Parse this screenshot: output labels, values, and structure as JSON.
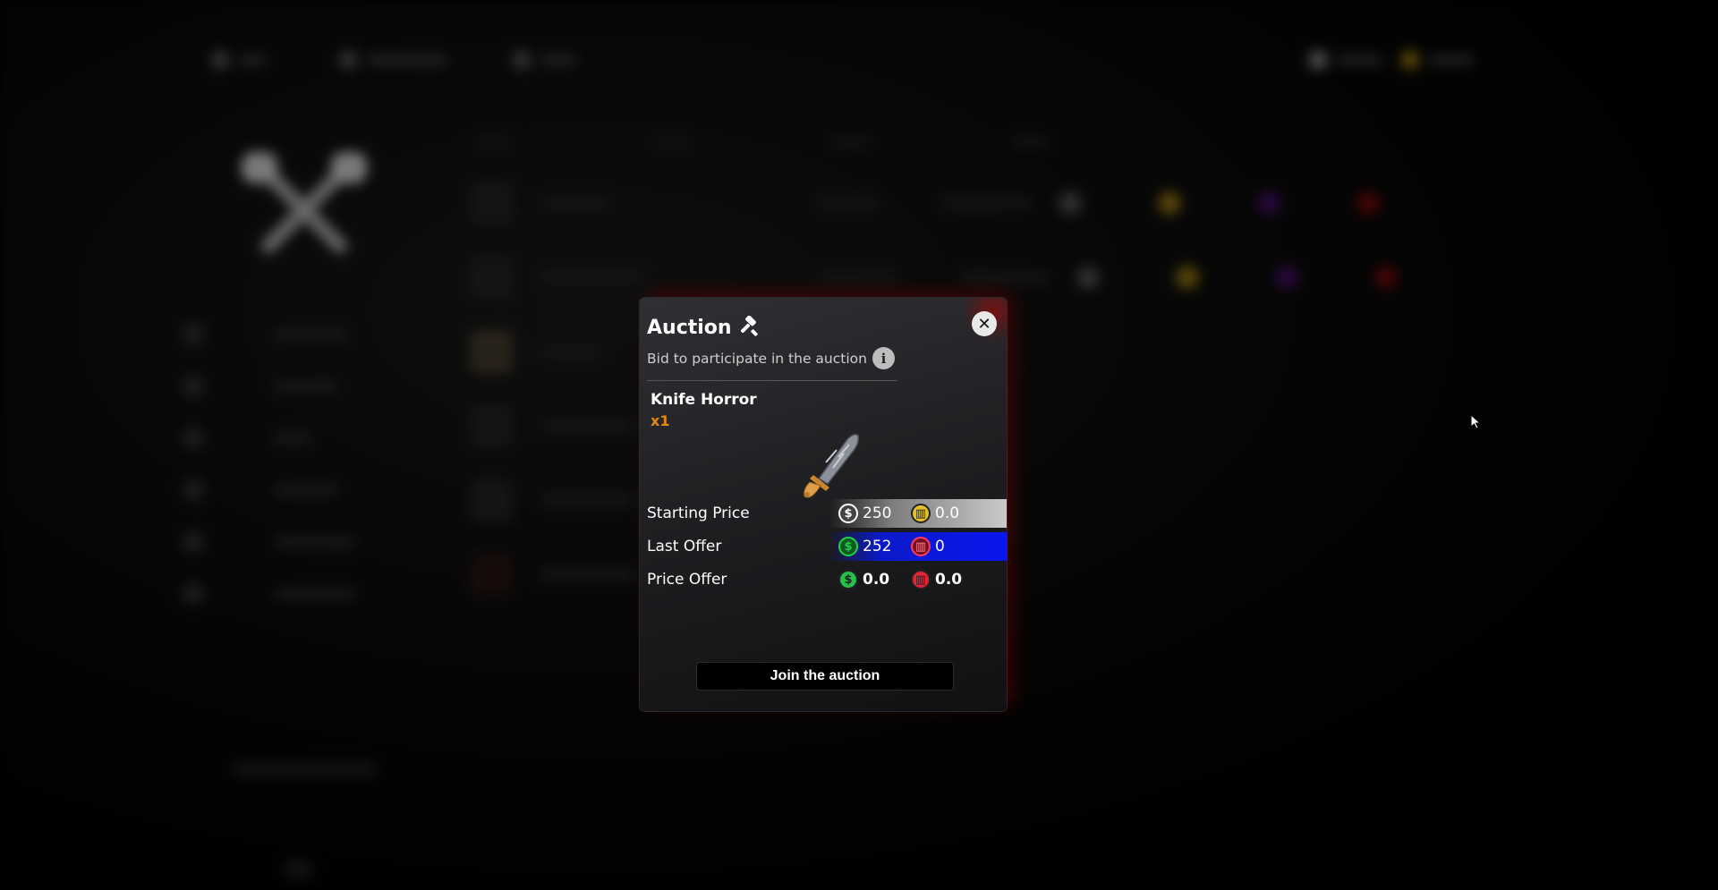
{
  "modal": {
    "title": "Auction",
    "subtitle": "Bid to participate in the auction",
    "item": {
      "name": "Knife Horror",
      "quantity": "x1"
    },
    "prices": [
      {
        "label": "Starting Price",
        "money": "250",
        "coins": "0.0"
      },
      {
        "label": "Last Offer",
        "money": "252",
        "coins": "0"
      },
      {
        "label": "Price Offer",
        "money": "0.0",
        "coins": "0.0"
      }
    ],
    "join_label": "Join the auction",
    "close_glyph": "✕",
    "info_glyph": "i"
  },
  "icons": {
    "title": "gavel-icon",
    "close": "close-icon",
    "info": "info-icon",
    "dollar": "dollar-coin-icon",
    "coin": "bank-coin-icon"
  },
  "colors": {
    "quantity": "#e8890f",
    "last_offer_bar": "#0a16f0",
    "starting_bar": "#cacaca",
    "money_green": "#1fd14a",
    "coin_red": "#e32437",
    "coin_gold": "#e4c12a"
  }
}
